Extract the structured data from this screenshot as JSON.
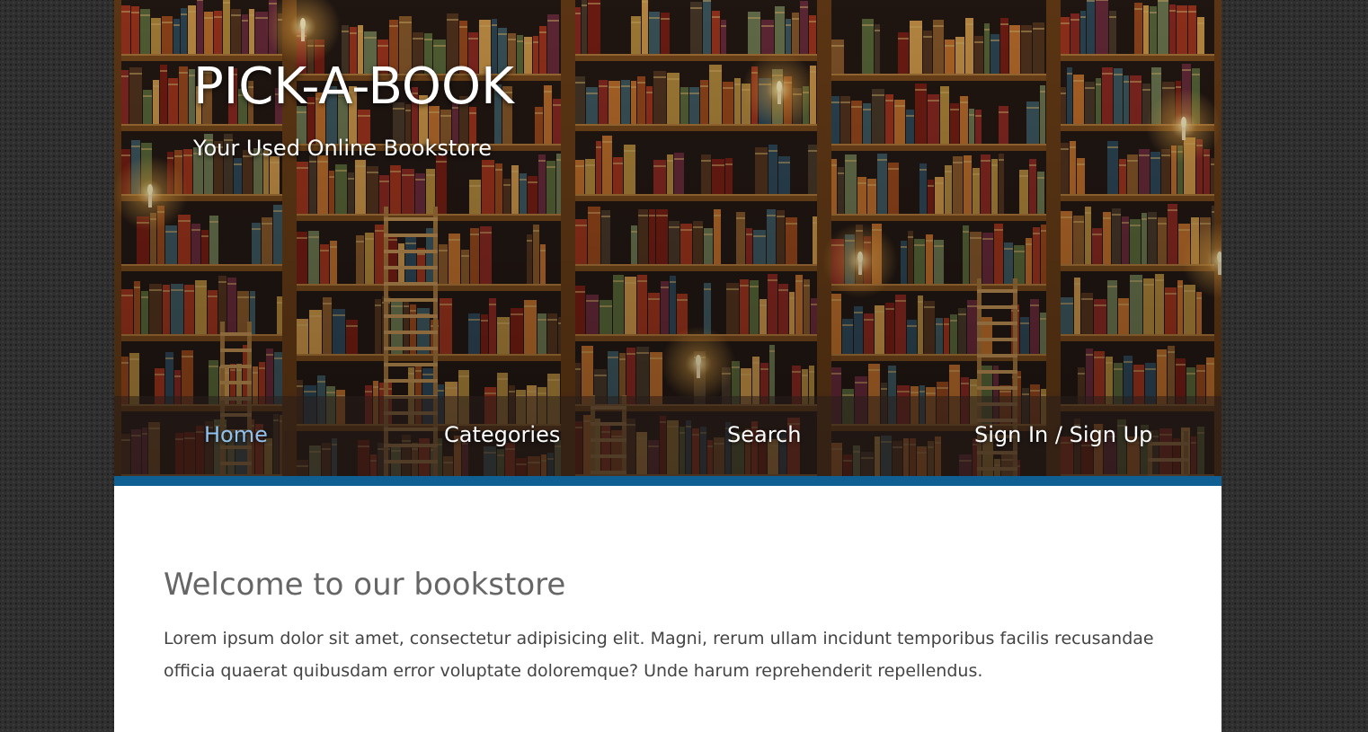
{
  "header": {
    "title": "PICK-A-BOOK",
    "tagline": "Your Used Online Bookstore",
    "background_image": "library-bookshelves-with-ladders-and-candles"
  },
  "nav": {
    "items": [
      {
        "label": "Home",
        "active": true
      },
      {
        "label": "Categories",
        "active": false
      },
      {
        "label": "Search",
        "active": false
      },
      {
        "label": "Sign In / Sign Up",
        "active": false
      }
    ]
  },
  "main": {
    "heading": "Welcome to our bookstore",
    "body": "Lorem ipsum dolor sit amet, consectetur adipisicing elit. Magni, rerum ullam incidunt temporibus facilis recusandae officia quaerat quibusdam error voluptate doloremque? Unde harum reprehenderit repellendus."
  },
  "colors": {
    "accent_bar": "#0f5f93",
    "nav_active": "#8fc2ee",
    "page_background": "#2f2f2f",
    "heading_text": "#666666",
    "body_text": "#444444"
  }
}
